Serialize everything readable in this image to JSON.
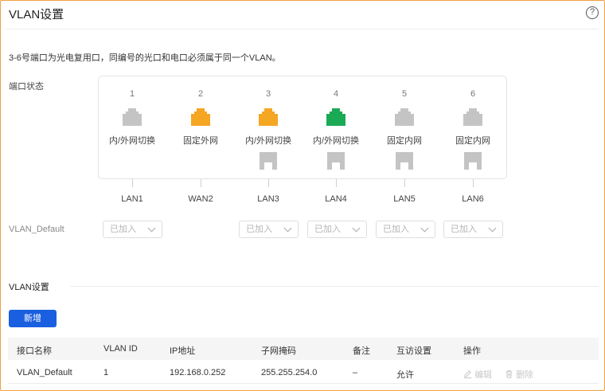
{
  "header": {
    "title": "VLAN设置",
    "help_icon": "?"
  },
  "note": "3-6号端口为光电复用口，同编号的光口和电口必须属于同一个VLAN。",
  "port_status": {
    "label": "端口状态",
    "ports": [
      {
        "num": "1",
        "mode": "内/外网切换",
        "rj45_color": "#c4c4c4",
        "has_sfp": false,
        "name": "LAN1"
      },
      {
        "num": "2",
        "mode": "固定外网",
        "rj45_color": "#f5a623",
        "has_sfp": false,
        "name": "WAN2"
      },
      {
        "num": "3",
        "mode": "内/外网切换",
        "rj45_color": "#f5a623",
        "has_sfp": true,
        "name": "LAN3"
      },
      {
        "num": "4",
        "mode": "内/外网切换",
        "rj45_color": "#1aaa55",
        "has_sfp": true,
        "name": "LAN4"
      },
      {
        "num": "5",
        "mode": "固定内网",
        "rj45_color": "#c4c4c4",
        "has_sfp": true,
        "name": "LAN5"
      },
      {
        "num": "6",
        "mode": "固定内网",
        "rj45_color": "#c4c4c4",
        "has_sfp": true,
        "name": "LAN6"
      }
    ]
  },
  "vlan_default_row": {
    "label": "VLAN_Default",
    "selects": [
      {
        "port": "LAN1",
        "value": "已加入"
      },
      {
        "port": "LAN3",
        "value": "已加入"
      },
      {
        "port": "LAN4",
        "value": "已加入"
      },
      {
        "port": "LAN5",
        "value": "已加入"
      },
      {
        "port": "LAN6",
        "value": "已加入"
      }
    ]
  },
  "vlan_section": {
    "title": "VLAN设置",
    "add_button": "新增",
    "columns": [
      "接口名称",
      "VLAN ID",
      "IP地址",
      "子网掩码",
      "备注",
      "互访设置",
      "操作"
    ],
    "rows": [
      {
        "name": "VLAN_Default",
        "vlan_id": "1",
        "ip": "192.168.0.252",
        "mask": "255.255.254.0",
        "remark": "–",
        "access": "允许",
        "edit": "编辑",
        "delete": "删除"
      }
    ]
  },
  "colors": {
    "accent": "#1a5fe0",
    "frame": "#f0a040"
  }
}
